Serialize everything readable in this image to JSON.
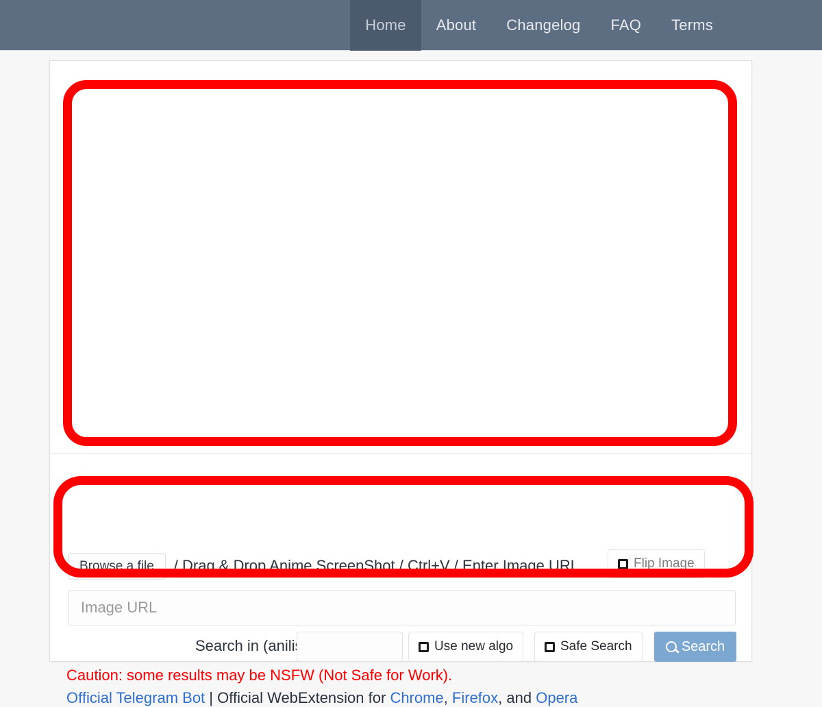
{
  "nav": {
    "items": [
      {
        "label": "Home",
        "active": true
      },
      {
        "label": "About",
        "active": false
      },
      {
        "label": "Changelog",
        "active": false
      },
      {
        "label": "FAQ",
        "active": false
      },
      {
        "label": "Terms",
        "active": false
      }
    ]
  },
  "colors": {
    "navbar_bg": "#5d6d82",
    "nav_active_bg": "#4b5a6d",
    "page_bg": "#f7f7f7",
    "card_bg": "#ffffff",
    "annotation_red": "#ff0000",
    "caution_red": "#ff0000",
    "link_blue": "#2f6fd0",
    "search_button_bg": "#7ba7d0"
  },
  "dropzone": {
    "content": ""
  },
  "form": {
    "browse_button": "Browse a file",
    "hint": "/ Drag & Drop Anime ScreenShot / Ctrl+V / Enter Image URL",
    "flip_image_label": "Flip Image",
    "flip_image_checked": false,
    "url_placeholder": "Image URL",
    "url_value": "",
    "anilist_label": "Search in (anilist ID):",
    "anilist_value": "",
    "anilist_placeholder": "",
    "use_new_algo_label": "Use new algo",
    "use_new_algo_checked": false,
    "safe_search_label": "Safe Search",
    "safe_search_checked": false,
    "search_button": "Search",
    "search_icon": "search-icon"
  },
  "footer": {
    "caution": "Caution: some results may be NSFW (Not Safe for Work).",
    "telegram_link": "Official Telegram Bot",
    "separator": " | ",
    "webext_prefix": "Official WebExtension for ",
    "chrome_link": "Chrome",
    "comma1": ", ",
    "firefox_link": "Firefox",
    "and_text": ", and ",
    "opera_link": "Opera"
  },
  "annotations": [
    {
      "name": "dropzone-highlight",
      "shape": "rounded-rect",
      "color": "#ff0000"
    },
    {
      "name": "form-highlight",
      "shape": "rounded-rect",
      "color": "#ff0000"
    }
  ]
}
